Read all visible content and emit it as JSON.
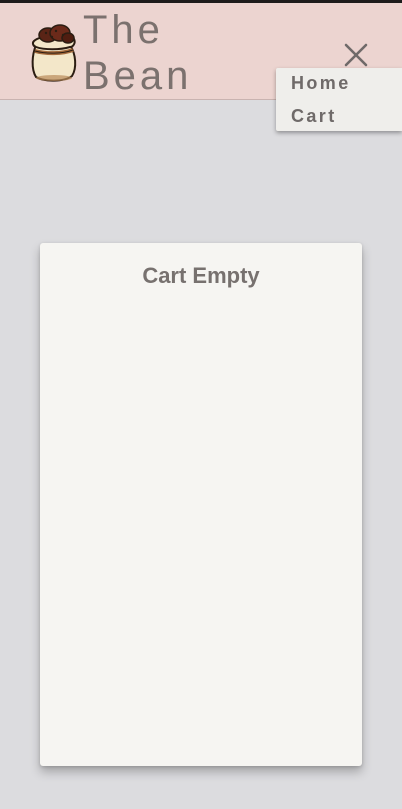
{
  "header": {
    "brand_line1": "The",
    "brand_line2": "Bean",
    "logo_icon": "coffee-bean-sack-icon",
    "close_icon": "close-icon",
    "background_color": "#ecd4d0"
  },
  "nav_menu": {
    "items": [
      {
        "label": "Home"
      },
      {
        "label": "Cart"
      }
    ]
  },
  "cart": {
    "title": "Cart Empty"
  }
}
